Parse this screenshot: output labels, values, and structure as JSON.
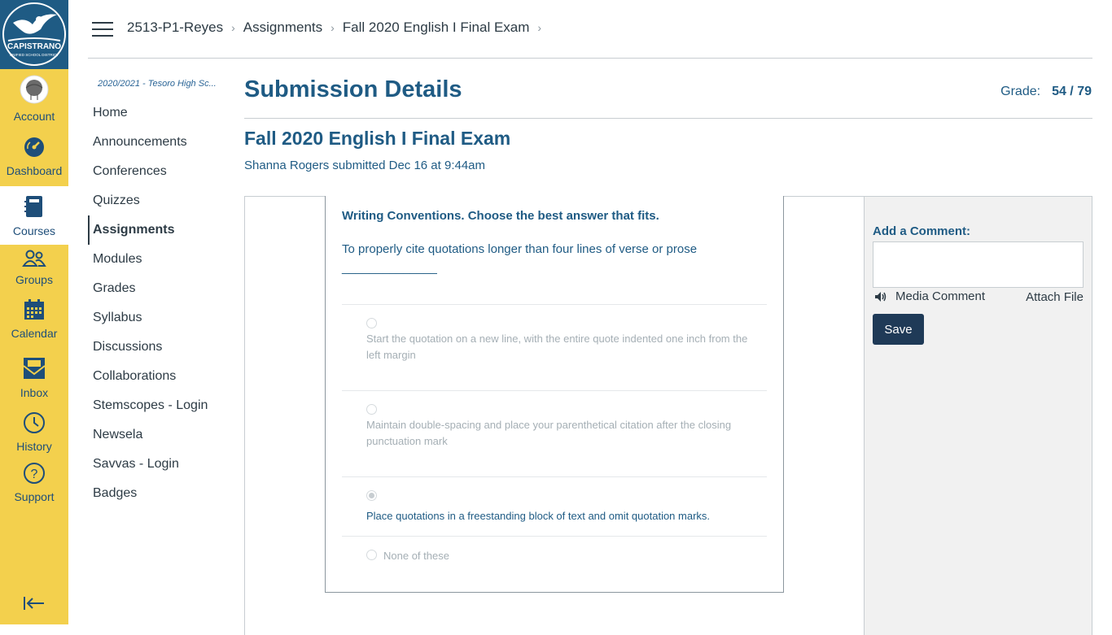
{
  "global_nav": {
    "logo_text": "CAPISTRANO",
    "logo_subtext": "UNIFIED SCHOOL DISTRICT",
    "items": [
      {
        "label": "Account",
        "icon": "avatar"
      },
      {
        "label": "Dashboard",
        "icon": "dashboard-icon"
      },
      {
        "label": "Courses",
        "icon": "courses-icon"
      },
      {
        "label": "Groups",
        "icon": "groups-icon"
      },
      {
        "label": "Calendar",
        "icon": "calendar-icon"
      },
      {
        "label": "Inbox",
        "icon": "inbox-icon"
      },
      {
        "label": "History",
        "icon": "history-icon"
      },
      {
        "label": "Support",
        "icon": "help-icon"
      }
    ],
    "collapse_icon": "collapse-icon"
  },
  "breadcrumb": [
    "2513-P1-Reyes",
    "Assignments",
    "Fall 2020 English I Final Exam"
  ],
  "course_nav": {
    "term": "2020/2021 - Tesoro High Sc...",
    "items": [
      "Home",
      "Announcements",
      "Conferences",
      "Quizzes",
      "Assignments",
      "Modules",
      "Grades",
      "Syllabus",
      "Discussions",
      "Collaborations",
      "Stemscopes - Login",
      "Newsela",
      "Savvas - Login",
      "Badges"
    ],
    "active": "Assignments"
  },
  "main": {
    "page_title": "Submission Details",
    "grade_label": "Grade:",
    "grade_value": "54 / 79",
    "assignment_title": "Fall 2020 English I Final Exam",
    "submitted_text": "Shanna Rogers submitted Dec 16 at 9:44am"
  },
  "question": {
    "heading": "Writing Conventions. Choose the best answer that fits.",
    "text": "To properly cite quotations longer than four lines of verse or prose",
    "blank": "______________",
    "answers": [
      {
        "text": "Start the quotation on a new line, with the entire quote indented one inch from the left margin",
        "selected": false
      },
      {
        "text": "Maintain double-spacing and place your parenthetical citation after the closing punctuation mark",
        "selected": false
      },
      {
        "text": "Place quotations in a freestanding block of text and omit quotation marks.",
        "selected": true
      },
      {
        "text": "None of these",
        "selected": false
      }
    ]
  },
  "comment_panel": {
    "label": "Add a Comment:",
    "media_label": "Media Comment",
    "attach_label": "Attach File",
    "save_label": "Save"
  },
  "colors": {
    "nav_bg": "#f3d04d",
    "brand_blue": "#1f5b84",
    "save_button": "#1f3a57"
  }
}
